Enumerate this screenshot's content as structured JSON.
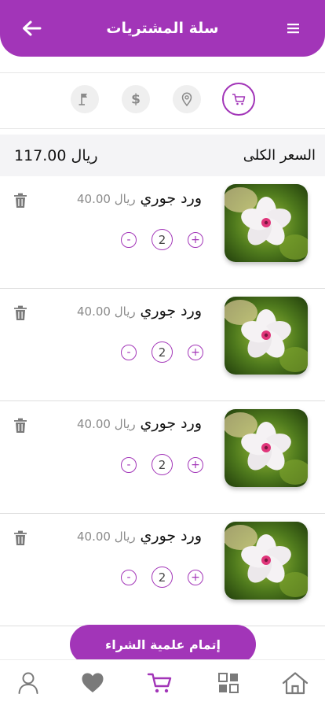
{
  "header": {
    "title": "سلة المشتريات",
    "back_icon": "arrow-left-icon",
    "menu_icon": "hamburger-menu-icon"
  },
  "colors": {
    "accent": "#a235b8",
    "step_bg": "#efefef",
    "total_bg": "#f4f4f6"
  },
  "steps": [
    {
      "name": "cart",
      "icon": "cart-icon",
      "active": true
    },
    {
      "name": "location",
      "icon": "location-pin-icon",
      "active": false
    },
    {
      "name": "payment",
      "icon": "dollar-icon",
      "active": false
    },
    {
      "name": "finish",
      "icon": "flag-icon",
      "active": false
    }
  ],
  "total": {
    "label": "السعر الكلى",
    "amount": "117.00  ريال"
  },
  "items": [
    {
      "name": "ورد جوري",
      "price": "40.00  ريال",
      "qty": "2",
      "plus": "+",
      "minus": "-"
    },
    {
      "name": "ورد جوري",
      "price": "40.00  ريال",
      "qty": "2",
      "plus": "+",
      "minus": "-"
    },
    {
      "name": "ورد جوري",
      "price": "40.00  ريال",
      "qty": "2",
      "plus": "+",
      "minus": "-"
    },
    {
      "name": "ورد جوري",
      "price": "40.00  ريال",
      "qty": "2",
      "plus": "+",
      "minus": "-"
    }
  ],
  "checkout": {
    "label": "إتمام علمية الشراء"
  },
  "bottom_nav": [
    {
      "name": "home",
      "icon": "home-icon",
      "active": false
    },
    {
      "name": "categories",
      "icon": "grid-icon",
      "active": false
    },
    {
      "name": "cart",
      "icon": "cart-icon",
      "active": true
    },
    {
      "name": "favorites",
      "icon": "heart-icon",
      "active": false
    },
    {
      "name": "profile",
      "icon": "user-icon",
      "active": false
    }
  ]
}
